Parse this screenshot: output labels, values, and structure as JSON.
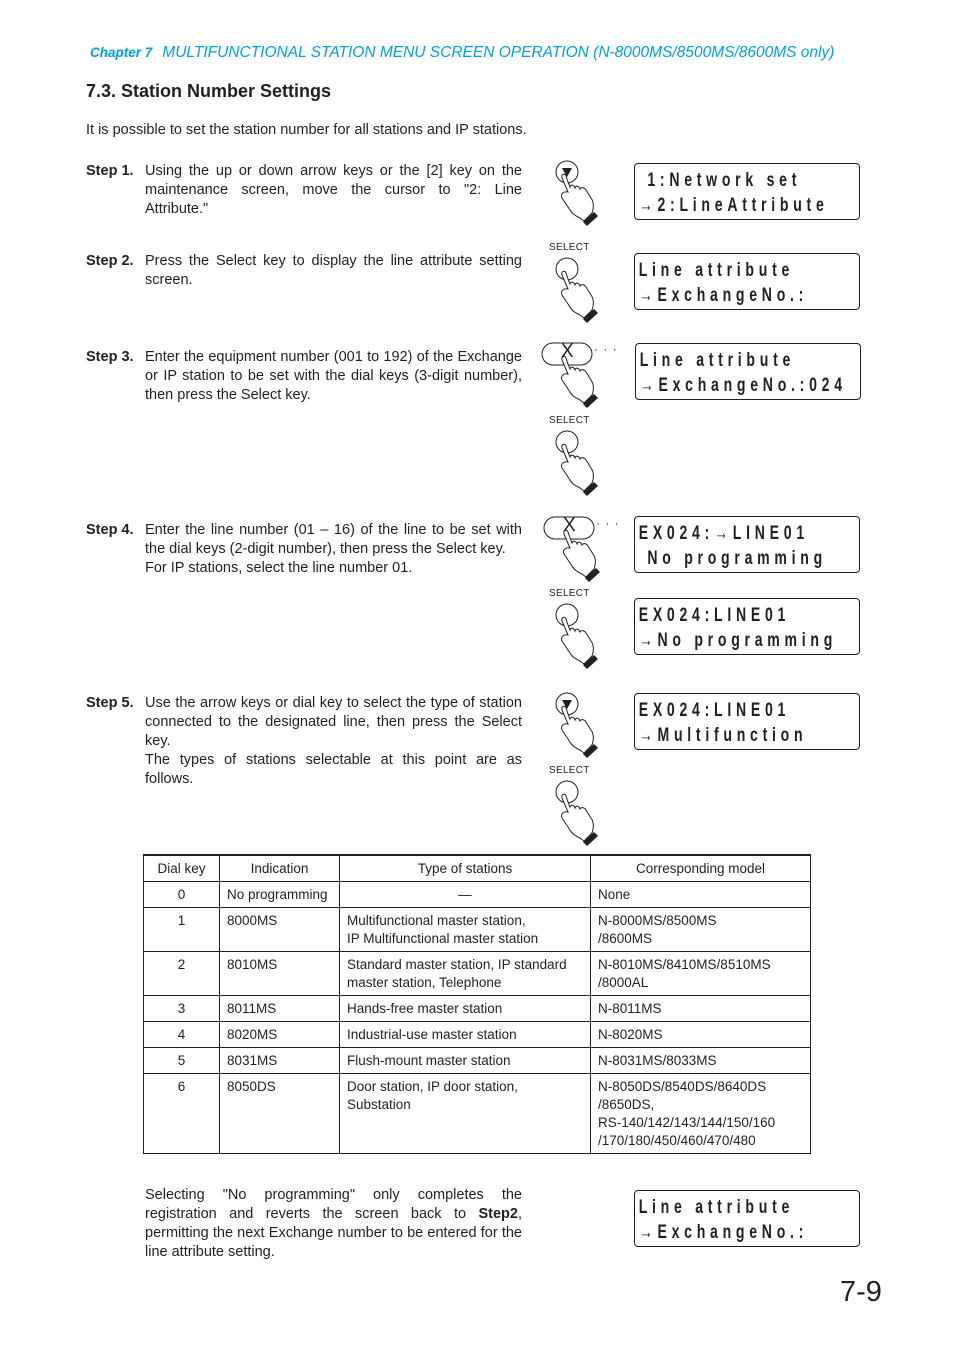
{
  "header": {
    "chapter_label": "Chapter 7",
    "chapter_title": "MULTIFUNCTIONAL STATION MENU SCREEN OPERATION (N-8000MS/8500MS/8600MS only)",
    "accent_color": "#00a0e0"
  },
  "section": {
    "title": "7.3. Station Number Settings",
    "intro": "It is possible to set the station number for all stations and IP stations."
  },
  "steps": [
    {
      "label": "Step 1.",
      "text": [
        "Using the up or down arrow keys or the [2] key on the maintenance screen, move the cursor to \"2: Line Attribute.\""
      ]
    },
    {
      "label": "Step 2.",
      "text": [
        "Press the Select key to display the line attribute setting screen."
      ]
    },
    {
      "label": "Step 3.",
      "text": [
        "Enter the equipment number (001 to 192) of the Exchange or IP station to be set with the dial keys (3-digit number), then press the Select key."
      ]
    },
    {
      "label": "Step 4.",
      "text": [
        "Enter the line number (01 – 16) of the line to be set with the dial keys (2-digit number), then press the Select key.",
        "For IP stations, select the line number 01."
      ]
    },
    {
      "label": "Step 5.",
      "text": [
        "Use the arrow keys or dial key to select the type of station connected to the designated line, then press the Select key.",
        "The types of stations selectable at this point are as follows."
      ]
    }
  ],
  "keys": {
    "select_label": "SELECT",
    "dial_key_label": "X",
    "dots": "· · ·"
  },
  "lcd_screens": [
    {
      "line1": " 1:Network set",
      "line2": "→2:LineAttribute"
    },
    {
      "line1": "Line attribute",
      "line2": "→ExchangeNo.:"
    },
    {
      "line1": "Line attribute",
      "line2": "→ExchangeNo.:024"
    },
    {
      "line1": "EX024:→LINE01",
      "line2": " No programming"
    },
    {
      "line1": "EX024:LINE01",
      "line2": "→No programming"
    },
    {
      "line1": "EX024:LINE01",
      "line2": "→Multifunction"
    },
    {
      "line1": "Line attribute",
      "line2": "→ExchangeNo.:"
    }
  ],
  "table": {
    "headers": [
      "Dial key",
      "Indication",
      "Type of stations",
      "Corresponding model"
    ],
    "rows": [
      {
        "key": "0",
        "indication": "No programming",
        "type": [
          "—"
        ],
        "model": [
          "None"
        ]
      },
      {
        "key": "1",
        "indication": "8000MS",
        "type": [
          "Multifunctional master station,",
          "IP Multifunctional master station"
        ],
        "model": [
          "N-8000MS/8500MS",
          "/8600MS"
        ]
      },
      {
        "key": "2",
        "indication": "8010MS",
        "type": [
          "Standard master station, IP standard",
          "master station, Telephone"
        ],
        "model": [
          "N-8010MS/8410MS/8510MS",
          "/8000AL"
        ]
      },
      {
        "key": "3",
        "indication": "8011MS",
        "type": [
          "Hands-free master station"
        ],
        "model": [
          "N-8011MS"
        ]
      },
      {
        "key": "4",
        "indication": "8020MS",
        "type": [
          "Industrial-use master station"
        ],
        "model": [
          "N-8020MS"
        ]
      },
      {
        "key": "5",
        "indication": "8031MS",
        "type": [
          "Flush-mount master station"
        ],
        "model": [
          "N-8031MS/8033MS"
        ]
      },
      {
        "key": "6",
        "indication": "8050DS",
        "type": [
          "Door station, IP door station,",
          "Substation"
        ],
        "model": [
          "N-8050DS/8540DS/8640DS",
          "/8650DS,",
          "RS-140/142/143/144/150/160",
          "/170/180/450/460/470/480"
        ]
      }
    ]
  },
  "note": {
    "before": "Selecting \"No programming\" only completes the registration and reverts the screen back to ",
    "bold": "Step2",
    "after": ", permitting the next Exchange number to be entered for the line attribute setting."
  },
  "page_number": "7-9"
}
